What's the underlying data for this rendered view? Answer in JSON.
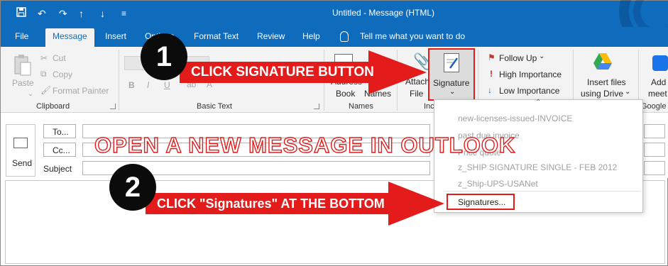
{
  "titlebar": {
    "title": "Untitled  -  Message (HTML)",
    "quick_access": [
      "save-icon",
      "undo-icon",
      "redo-icon",
      "up-icon",
      "down-icon",
      "customize-icon"
    ]
  },
  "menu": {
    "items": [
      "File",
      "Message",
      "Insert",
      "Options",
      "Format Text",
      "Review",
      "Help"
    ],
    "active": "Message",
    "tell_me": "Tell me what you want to do"
  },
  "ribbon": {
    "clipboard": {
      "label": "Clipboard",
      "paste": "Paste",
      "cut": "Cut",
      "copy": "Copy",
      "format_painter": "Format Painter"
    },
    "basic_text": {
      "label": "Basic Text",
      "bold": "B",
      "italic": "I",
      "underline": "U"
    },
    "names": {
      "label": "Names",
      "address_book_l1": "Address",
      "address_book_l2": "Book",
      "check_names": "Names"
    },
    "include": {
      "label_partial": "Inc",
      "attach_l1": "Attach",
      "attach_l2": "File",
      "signature": "Signature",
      "signature_caret": "⌄"
    },
    "tags": {
      "follow_up": "Follow Up",
      "high_importance": "High Importance",
      "low_importance": "Low Importance"
    },
    "google": {
      "insert_files_l1": "Insert files",
      "insert_files_l2": "using Drive",
      "label_partial": "Google",
      "add_l1": "Add",
      "add_l2": "meet"
    }
  },
  "compose": {
    "send": "Send",
    "to": "To...",
    "cc": "Cc...",
    "subject": "Subject"
  },
  "signature_menu": {
    "items": [
      "new-licenses-issued-INVOICE",
      "past due invoice",
      "Price quote",
      "z_SHIP SIGNATURE SINGLE - FEB 2012",
      "z_Ship-UPS-USANet"
    ],
    "signatures_link": "Signatures..."
  },
  "annotations": {
    "step1_number": "1",
    "step1_text": "CLICK SIGNATURE BUTTON",
    "step2_number": "2",
    "step2_text": "CLICK \"Signatures\" AT THE BOTTOM",
    "headline": "OPEN A NEW MESSAGE IN OUTLOOK",
    "arrow_color": "#e41b1b"
  }
}
